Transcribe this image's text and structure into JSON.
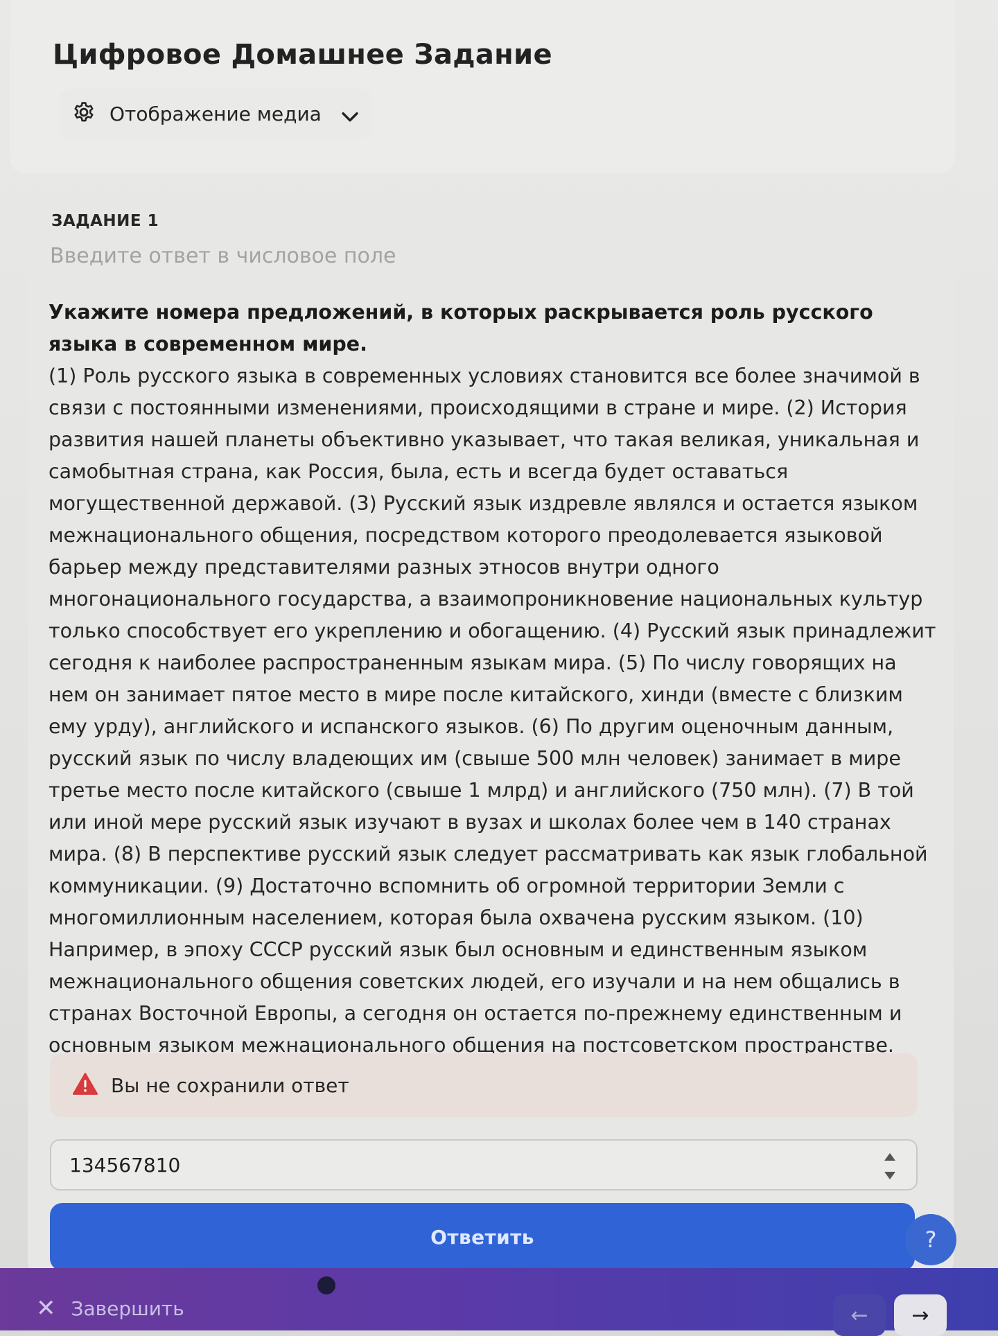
{
  "header": {
    "title": "Цифровое Домашнее Задание",
    "media_toggle_label": "Отображение медиа"
  },
  "task": {
    "number_label": "ЗАДАНИЕ 1",
    "hint": "Введите ответ в числовое поле",
    "question": "Укажите номера предложений, в которых раскрывается роль русского языка в современном мире.",
    "text": "(1) Роль русского языка в современных условиях становится все более значимой в связи с постоянными изменениями, происходящими в стране и мире. (2) История развития нашей планеты объективно указывает, что такая великая, уникальная и самобытная страна, как Россия, была, есть и всегда будет оставаться могущественной державой. (3) Русский язык издревле являлся и остается языком межнационального общения, посредством которого преодолевается языковой барьер между представителями разных этносов внутри одного многонационального государства, а взаимопроникновение национальных культур только способствует его укреплению и обогащению. (4) Русский язык принадлежит сегодня к наиболее распространенным языкам мира. (5) По числу говорящих на нем он занимает пятое место в мире после китайского, хинди (вместе с близким ему урду), английского и испанского языков. (6) По другим оценочным данным, русский язык по числу владеющих им (свыше 500 млн человек) занимает в мире третье место после китайского (свыше 1 млрд) и английского (750 млн). (7) В той или иной мере русский язык изучают в вузах и школах более чем в 140 странах мира. (8) В перспективе русский язык следует рассматривать как язык глобальной коммуникации. (9) Достаточно вспомнить об огромной территории Земли с многомиллионным населением, которая была охвачена русским языком. (10) Например, в эпоху СССР русский язык был основным и единственным языком межнационального общения советских людей, его изучали и на нем общались в странах Восточной Европы, а сегодня он остается по-прежнему единственным и основным языком межнационального общения на постсоветском пространстве."
  },
  "warning": {
    "text": "Вы не сохранили ответ",
    "color": "#d93a3a"
  },
  "answer": {
    "value": "134567810"
  },
  "submit_label": "Ответить",
  "help_label": "?",
  "footer": {
    "finish_label": "Завершить",
    "prev_glyph": "←",
    "next_glyph": "→"
  },
  "colors": {
    "accent": "#2f63d6",
    "footer_start": "#6b3a9a",
    "footer_end": "#3e3fae"
  }
}
